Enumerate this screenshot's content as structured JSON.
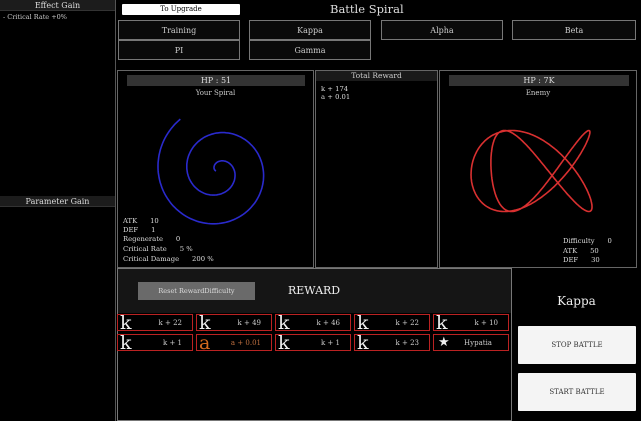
{
  "left_panel": {
    "effect_gain_title": "Effect Gain",
    "effect_gain_line": "- Critical Rate      +0%",
    "parameter_gain_title": "Parameter Gain"
  },
  "top": {
    "upgrade_button": "To Upgrade",
    "title": "Battle Spiral",
    "tabs": [
      "Training",
      "Kappa",
      "Alpha",
      "Beta",
      "PI",
      "Gamma"
    ]
  },
  "player": {
    "hp_label": "HP : 51",
    "name": "Your Spiral",
    "spiral_color": "#2a2acc",
    "stats": [
      "ATK      10",
      "DEF      1",
      "Regenerate      0",
      "Critical Rate      5 %",
      "Critical Damage      200 %"
    ]
  },
  "reward_box": {
    "title": "Total Reward",
    "lines": [
      "k + 174",
      "a + 0.01"
    ]
  },
  "enemy": {
    "hp_label": "HP : 7K",
    "name": "Enemy",
    "curve_color": "#d83030",
    "stats": [
      "Difficulty      0",
      "ATK      50",
      "DEF      30"
    ]
  },
  "rewards": {
    "reset_button": "Reset RewardDifficulty",
    "heading": "REWARD",
    "row1": [
      {
        "glyph": "k",
        "text": "k + 22"
      },
      {
        "glyph": "k",
        "text": "k + 49"
      },
      {
        "glyph": "k",
        "text": "k + 46"
      },
      {
        "glyph": "k",
        "text": "k + 22"
      },
      {
        "glyph": "k",
        "text": "k + 10"
      }
    ],
    "row2": [
      {
        "glyph": "k",
        "text": "k + 1"
      },
      {
        "glyph": "a",
        "text": "a + 0.01"
      },
      {
        "glyph": "k",
        "text": "k + 1"
      },
      {
        "glyph": "k",
        "text": "k + 23"
      },
      {
        "glyph": "★",
        "text": "Hypatia"
      }
    ]
  },
  "side": {
    "current": "Kappa",
    "stop_button": "STOP BATTLE",
    "start_button": "START BATTLE"
  },
  "colors": {
    "card_border": "#b22222",
    "a_glyph": "#d2691e"
  }
}
